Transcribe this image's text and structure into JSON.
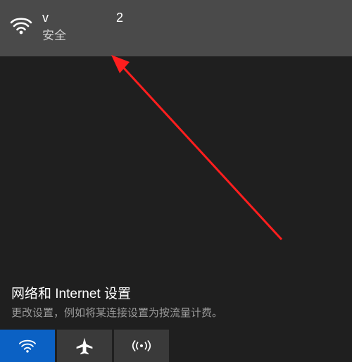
{
  "network": {
    "ssid_prefix": "v",
    "ssid_suffix": "2",
    "security_label": "安全"
  },
  "settings": {
    "title": "网络和 Internet 设置",
    "description": "更改设置，例如将某连接设置为按流量计费。"
  },
  "quick_actions": {
    "wifi_label": "WLAN",
    "airplane_label": "飞行模式",
    "hotspot_label": "移动热点"
  }
}
